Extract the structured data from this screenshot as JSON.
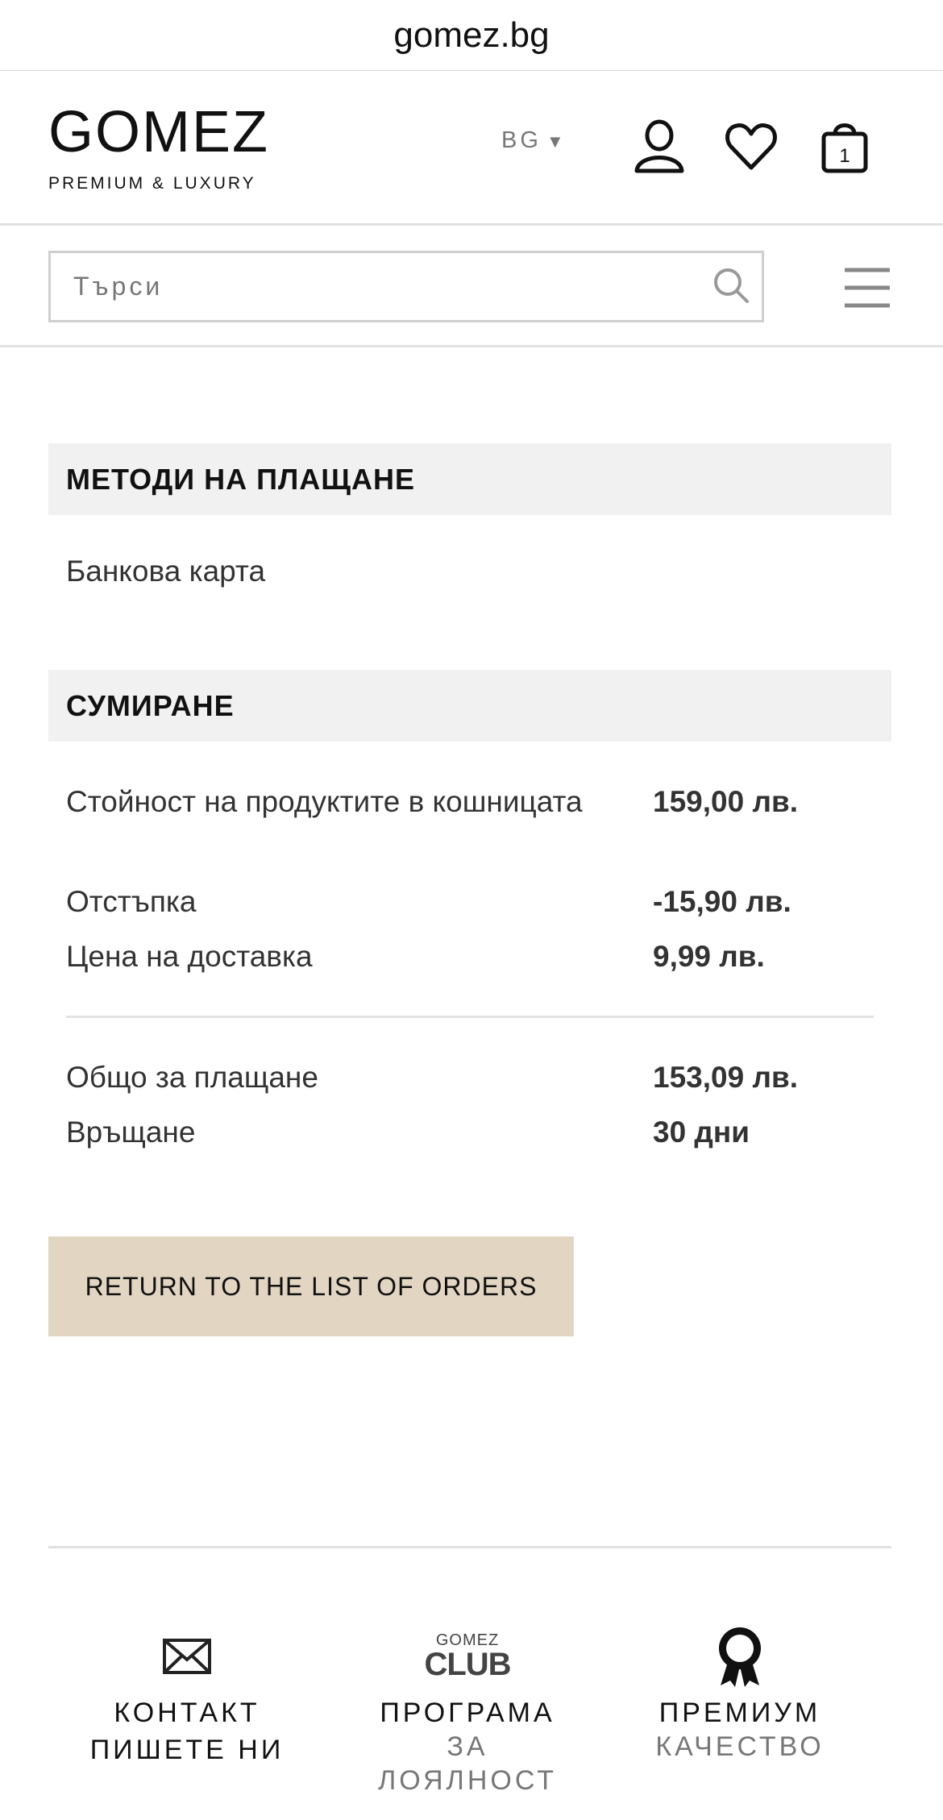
{
  "browser": {
    "url": "gomez.bg"
  },
  "header": {
    "logo_main": "GOMEZ",
    "logo_sub": "PREMIUM & LUXURY",
    "language": "BG",
    "cart_count": "1"
  },
  "search": {
    "placeholder": "Търси"
  },
  "payment": {
    "title": "МЕТОДИ НА ПЛАЩАНЕ",
    "method": "Банкова карта"
  },
  "summary": {
    "title": "СУМИРАНЕ",
    "rows": [
      {
        "label": "Стойност на продуктите в кошницата",
        "value": "159,00 лв."
      },
      {
        "label": "Отстъпка",
        "value": "-15,90 лв."
      },
      {
        "label": "Цена на доставка",
        "value": "9,99 лв."
      }
    ],
    "totals": [
      {
        "label": "Общо за плащане",
        "value": "153,09 лв."
      },
      {
        "label": "Връщане",
        "value": "30 дни"
      }
    ]
  },
  "actions": {
    "return_label": "RETURN TO THE LIST OF ORDERS"
  },
  "footer": {
    "club_logo_top": "GOMEZ",
    "club_logo_bottom": "CLUB",
    "features": [
      {
        "icon": "envelope-icon",
        "line1": "КОНТАКТ",
        "line2": "ПИШЕТЕ НИ"
      },
      {
        "icon": "club-logo-icon",
        "line1": "ПРОГРАМА",
        "line2": "ЗА",
        "line3": "ЛОЯЛНОСТ"
      },
      {
        "icon": "award-ribbon-icon",
        "line1": "ПРЕМИУМ",
        "line2": "КАЧЕСТВО"
      }
    ]
  }
}
